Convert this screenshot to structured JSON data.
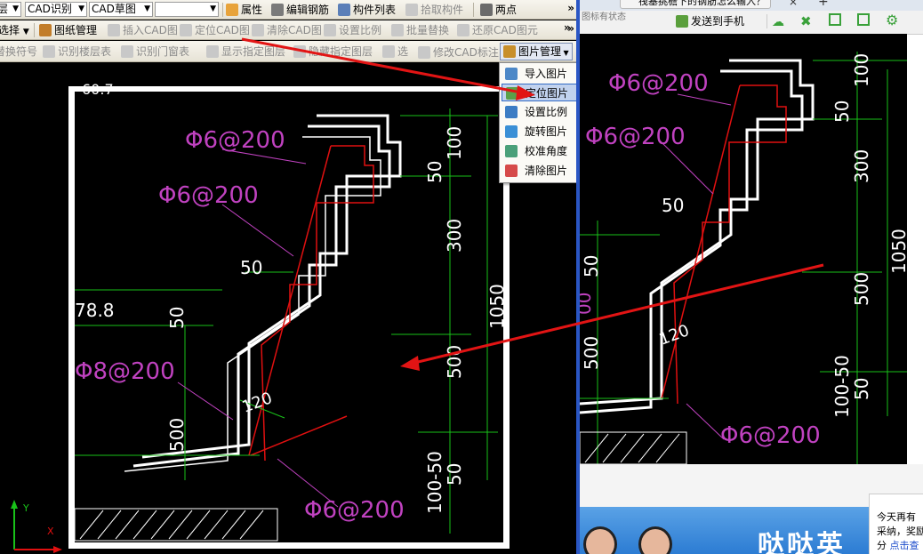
{
  "toolbar1": {
    "combo1": "层",
    "combo2": "CAD识别",
    "combo3": "CAD草图",
    "combo4": "",
    "attr_label": "属性",
    "edit_rebar_label": "编辑钢筋",
    "component_list_label": "构件列表",
    "pick_component_label": "拾取构件",
    "two_points_label": "两点"
  },
  "toolbar2": {
    "select_label": "选择",
    "drawing_mgmt_label": "图纸管理",
    "insert_cad_label": "插入CAD图",
    "locate_cad_label": "定位CAD图",
    "clear_cad_label": "清除CAD图",
    "set_scale_label": "设置比例",
    "batch_replace_label": "批量替换",
    "restore_cad_label": "还原CAD图元"
  },
  "toolbar3": {
    "swap_symbol_label": "替换符号",
    "recognize_floor_table_label": "识别楼层表",
    "recognize_door_window_label": "识别门窗表",
    "show_layer_label": "显示指定图层",
    "hide_layer_label": "隐藏指定图层",
    "select_label": "选",
    "modify_cad_label": "修改CAD标注",
    "image_mgmt_label": "图片管理"
  },
  "image_menu": {
    "items": [
      "导入图片",
      "定位图片",
      "设置比例",
      "旋转图片",
      "校准角度",
      "清除图片"
    ],
    "selected_index": 1
  },
  "left_drawing": {
    "labels": {
      "dim_top": "60.7",
      "rebar_1": "Φ6@200",
      "rebar_2": "Φ6@200",
      "rebar_3": "Φ8@200",
      "rebar_4": "Φ6@200",
      "dim_78_8": "78.8",
      "dim_50a": "50",
      "dim_50b": "50",
      "dim_500a": "500",
      "dim_120": "120",
      "dim_100": "100",
      "dim_50c": "50",
      "dim_300": "300",
      "dim_1050": "1050",
      "dim_500b": "500",
      "dim_100_50": "100-50",
      "dim_50d": "50"
    },
    "axes": {
      "y": "Y",
      "x": "X"
    }
  },
  "right_window": {
    "tab_title": "筏基挑檐下的钢筋怎么输入？",
    "tab_close": "×",
    "new_tab": "+",
    "small_text": "图标有状态",
    "send_to_phone_label": "发送到手机",
    "popup_line1": "今天再有",
    "popup_line2": "采纳，奖励",
    "popup_line3": "分",
    "popup_link": "点击查",
    "banner_text": "哒哒英"
  },
  "right_drawing": {
    "labels": {
      "rebar_1": "Φ6@200",
      "rebar_2": "Φ6@200",
      "rebar_3": "Φ6@200",
      "dim_100": "100",
      "dim_50a": "50",
      "dim_300": "300",
      "dim_50b": "50",
      "dim_50c": "50",
      "dim_1050": "1050",
      "dim_500a": "500",
      "dim_120": "120",
      "dim_500b": "500",
      "dim_100_50": "100-50",
      "dim_50d": "50",
      "dim_00": "00"
    }
  },
  "colors": {
    "magenta": "#c042c0",
    "green": "#19c119",
    "white": "#ffffff",
    "red": "#e01010",
    "annot_arrow": "#e21414",
    "selection": "#c1d2ee"
  }
}
